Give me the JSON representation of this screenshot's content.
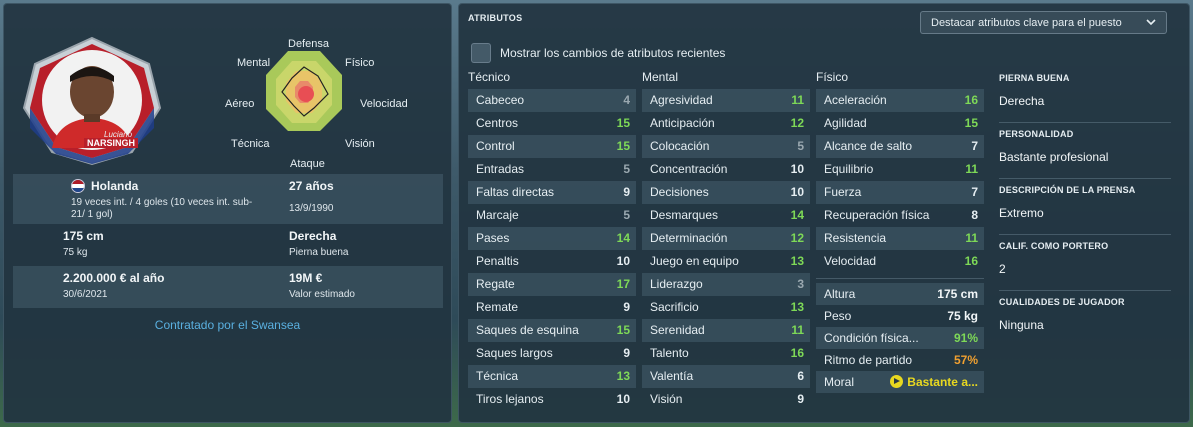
{
  "colors": {
    "green": "#7ed957",
    "white": "#e6eef2",
    "grey": "#9aa8b0",
    "orange": "#f0a030",
    "yellow": "#e8d820",
    "link": "#5ab0e0"
  },
  "player": {
    "badge_first_name": "Luciano",
    "badge_last_name": "NARSINGH",
    "nationality": "Holanda",
    "caps": "19 veces int. / 4 goles (10 veces int. sub-21/ 1 gol)",
    "age": "27 años",
    "dob": "13/9/1990",
    "height": "175 cm",
    "weight": "75 kg",
    "foot": "Derecha",
    "foot_label": "Pierna buena",
    "wage": "2.200.000 € al año",
    "contract_end": "30/6/2021",
    "value": "19M €",
    "value_label": "Valor estimado",
    "contract_link": "Contratado por el Swansea"
  },
  "radar": {
    "labels": [
      "Defensa",
      "Físico",
      "Velocidad",
      "Visión",
      "Ataque",
      "Técnica",
      "Aéreo",
      "Mental"
    ]
  },
  "attributes": {
    "title": "ATRIBUTOS",
    "highlight_dropdown": "Destacar atributos clave para el puesto",
    "show_changes": "Mostrar los cambios de atributos recientes",
    "tecnico_head": "Técnico",
    "mental_head": "Mental",
    "fisico_head": "Físico",
    "tecnico": [
      {
        "name": "Cabeceo",
        "value": "4",
        "color": "#9aa8b0"
      },
      {
        "name": "Centros",
        "value": "15",
        "color": "#7ed957"
      },
      {
        "name": "Control",
        "value": "15",
        "color": "#7ed957"
      },
      {
        "name": "Entradas",
        "value": "5",
        "color": "#9aa8b0"
      },
      {
        "name": "Faltas directas",
        "value": "9",
        "color": "#e6eef2"
      },
      {
        "name": "Marcaje",
        "value": "5",
        "color": "#9aa8b0"
      },
      {
        "name": "Pases",
        "value": "14",
        "color": "#7ed957"
      },
      {
        "name": "Penaltis",
        "value": "10",
        "color": "#e6eef2"
      },
      {
        "name": "Regate",
        "value": "17",
        "color": "#7ed957"
      },
      {
        "name": "Remate",
        "value": "9",
        "color": "#e6eef2"
      },
      {
        "name": "Saques de esquina",
        "value": "15",
        "color": "#7ed957"
      },
      {
        "name": "Saques largos",
        "value": "9",
        "color": "#e6eef2"
      },
      {
        "name": "Técnica",
        "value": "13",
        "color": "#7ed957"
      },
      {
        "name": "Tiros lejanos",
        "value": "10",
        "color": "#e6eef2"
      }
    ],
    "mental": [
      {
        "name": "Agresividad",
        "value": "11",
        "color": "#7ed957"
      },
      {
        "name": "Anticipación",
        "value": "12",
        "color": "#7ed957"
      },
      {
        "name": "Colocación",
        "value": "5",
        "color": "#9aa8b0"
      },
      {
        "name": "Concentración",
        "value": "10",
        "color": "#e6eef2"
      },
      {
        "name": "Decisiones",
        "value": "10",
        "color": "#e6eef2"
      },
      {
        "name": "Desmarques",
        "value": "14",
        "color": "#7ed957"
      },
      {
        "name": "Determinación",
        "value": "12",
        "color": "#7ed957"
      },
      {
        "name": "Juego en equipo",
        "value": "13",
        "color": "#7ed957"
      },
      {
        "name": "Liderazgo",
        "value": "3",
        "color": "#9aa8b0"
      },
      {
        "name": "Sacrificio",
        "value": "13",
        "color": "#7ed957"
      },
      {
        "name": "Serenidad",
        "value": "11",
        "color": "#7ed957"
      },
      {
        "name": "Talento",
        "value": "16",
        "color": "#7ed957"
      },
      {
        "name": "Valentía",
        "value": "6",
        "color": "#e6eef2"
      },
      {
        "name": "Visión",
        "value": "9",
        "color": "#e6eef2"
      }
    ],
    "fisico": [
      {
        "name": "Aceleración",
        "value": "16",
        "color": "#7ed957"
      },
      {
        "name": "Agilidad",
        "value": "15",
        "color": "#7ed957"
      },
      {
        "name": "Alcance de salto",
        "value": "7",
        "color": "#e6eef2"
      },
      {
        "name": "Equilibrio",
        "value": "11",
        "color": "#7ed957"
      },
      {
        "name": "Fuerza",
        "value": "7",
        "color": "#e6eef2"
      },
      {
        "name": "Recuperación física",
        "value": "8",
        "color": "#e6eef2"
      },
      {
        "name": "Resistencia",
        "value": "11",
        "color": "#7ed957"
      },
      {
        "name": "Velocidad",
        "value": "16",
        "color": "#7ed957"
      }
    ],
    "extras": [
      {
        "name": "Altura",
        "value": "175 cm",
        "color": "#f2f6f8"
      },
      {
        "name": "Peso",
        "value": "75 kg",
        "color": "#f2f6f8"
      },
      {
        "name": "Condición física...",
        "value": "91%",
        "color": "#7ed957"
      },
      {
        "name": "Ritmo de partido",
        "value": "57%",
        "color": "#f0a030"
      },
      {
        "name": "Moral",
        "value": "Bastante a...",
        "color": "#e8d820"
      }
    ]
  },
  "side": {
    "pierna_label": "PIERNA BUENA",
    "pierna_value": "Derecha",
    "personalidad_label": "PERSONALIDAD",
    "personalidad_value": "Bastante profesional",
    "prensa_label": "DESCRIPCIÓN DE LA PRENSA",
    "prensa_value": "Extremo",
    "portero_label": "CALIF. COMO PORTERO",
    "portero_value": "2",
    "cualidades_label": "CUALIDADES DE JUGADOR",
    "cualidades_value": "Ninguna"
  }
}
